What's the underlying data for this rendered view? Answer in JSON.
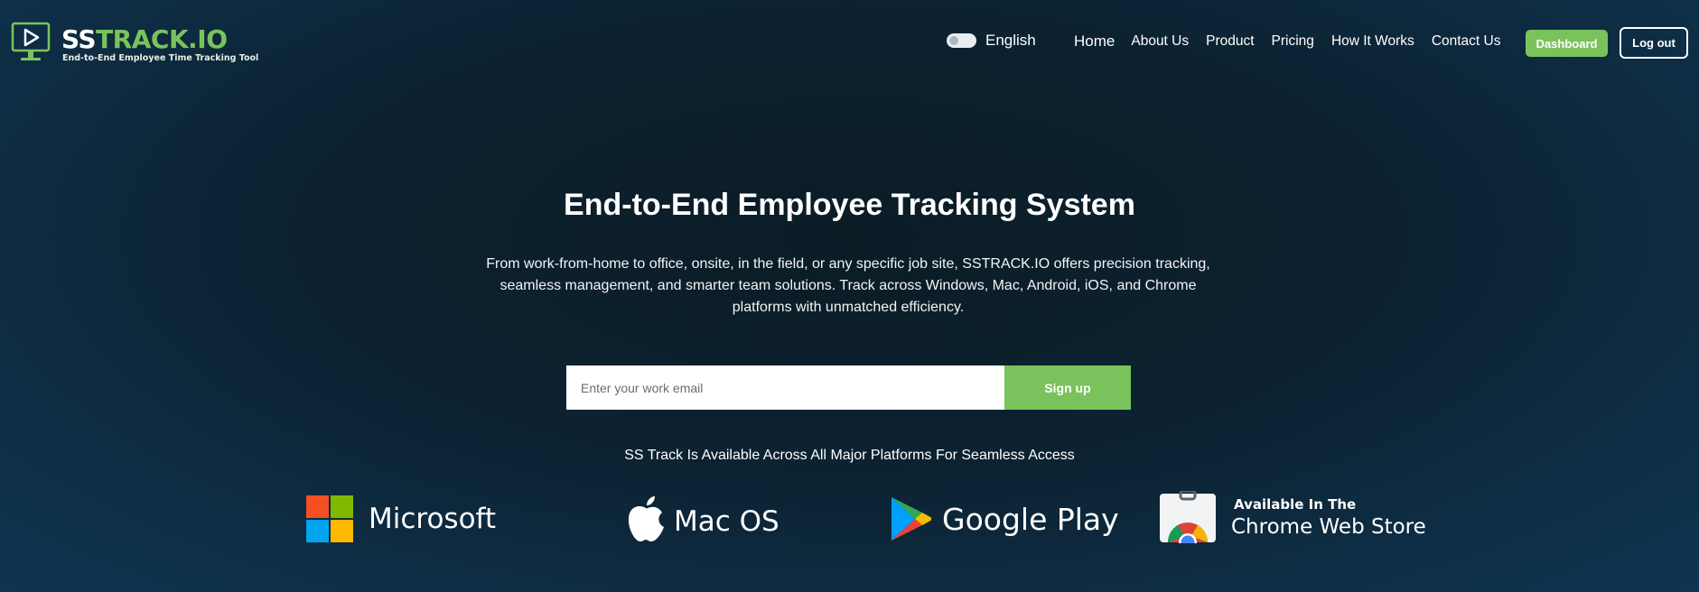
{
  "brand": {
    "name_part1": "SS",
    "name_part2": "TRACK.IO",
    "tagline": "End-to-End Employee Time Tracking Tool",
    "logo_icon": "monitor-play-icon",
    "accent_color": "#7ac35c"
  },
  "language": {
    "label": "English",
    "toggle_icon": "toggle-switch-icon"
  },
  "nav": {
    "items": [
      {
        "label": "Home"
      },
      {
        "label": "About Us"
      },
      {
        "label": "Product"
      },
      {
        "label": "Pricing"
      },
      {
        "label": "How It Works"
      },
      {
        "label": "Contact Us"
      }
    ]
  },
  "header_actions": {
    "dashboard_label": "Dashboard",
    "logout_label": "Log out"
  },
  "hero": {
    "title": "End-to-End Employee Tracking System",
    "description": "From work-from-home to office, onsite, in the field, or any specific job site, SSTRACK.IO offers precision tracking, seamless management, and smarter team solutions. Track across Windows, Mac, Android, iOS, and Chrome platforms with unmatched efficiency."
  },
  "signup": {
    "email_placeholder": "Enter your work email",
    "email_value": "",
    "button_label": "Sign up"
  },
  "platforms": {
    "caption": "SS Track Is Available Across All Major Platforms For Seamless Access",
    "microsoft": {
      "label": "Microsoft",
      "icon": "windows-logo-icon"
    },
    "mac": {
      "label": "Mac OS",
      "icon": "apple-logo-icon"
    },
    "google_play": {
      "label": "Google Play",
      "icon": "google-play-logo-icon"
    },
    "chrome": {
      "label_top": "Available In The",
      "label_bottom": "Chrome Web Store",
      "icon": "chrome-web-store-icon"
    }
  },
  "colors": {
    "background_dark": "#0b1c25",
    "background_edge": "#0f3552",
    "button_green": "#7ac35c"
  }
}
